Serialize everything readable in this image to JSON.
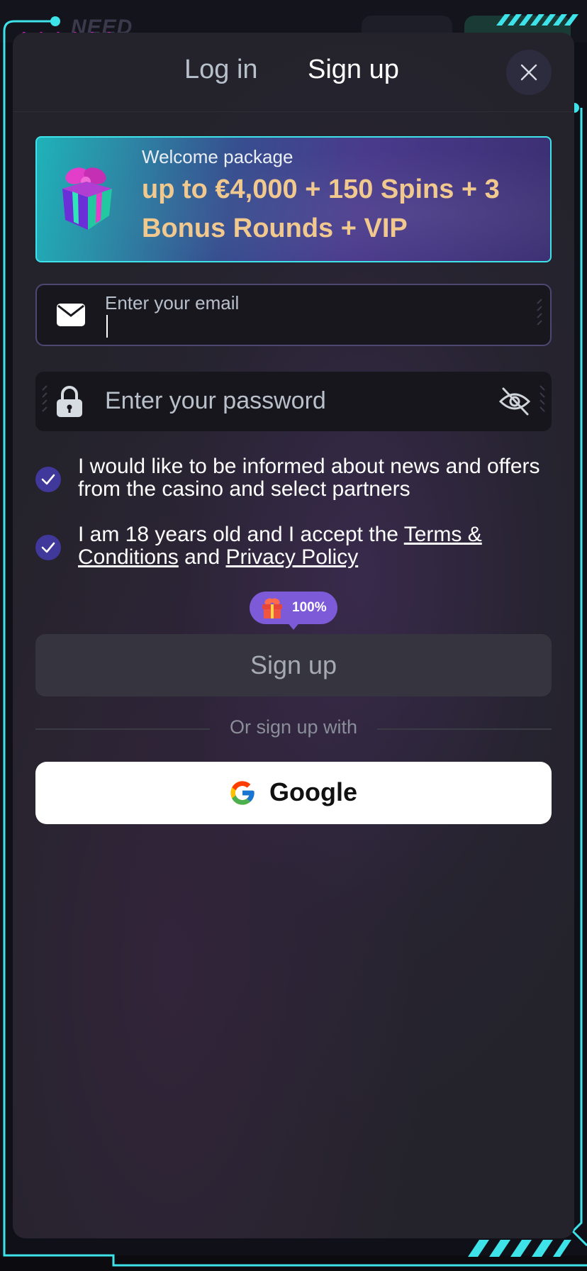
{
  "background": {
    "logo_text": "NEED"
  },
  "tabs": [
    {
      "label": "Log in",
      "active": false
    },
    {
      "label": "Sign up",
      "active": true
    }
  ],
  "close_icon": "close-icon",
  "banner": {
    "subtitle": "Welcome package",
    "offer": "up to €4,000 + 150 Spins + 3 Bonus Rounds + VIP",
    "icon": "gift-icon"
  },
  "email": {
    "label": "Enter your email",
    "value": "",
    "icon": "envelope-icon"
  },
  "password": {
    "placeholder": "Enter your password",
    "value": "",
    "icon": "lock-icon",
    "toggle_icon": "eye-off-icon"
  },
  "consents": {
    "news": {
      "checked": true,
      "text": "I would like to be informed about news and offers from the casino and select partners"
    },
    "terms": {
      "checked": true,
      "prefix": "I am 18 years old and I accept the ",
      "terms_link": "Terms & Conditions",
      "and": " and ",
      "privacy_link": "Privacy Policy"
    }
  },
  "bonus_badge": {
    "percent": "100%",
    "icon": "gift-icon"
  },
  "signup_button": {
    "label": "Sign up"
  },
  "divider": {
    "text": "Or sign up with"
  },
  "google_button": {
    "label": "Google",
    "icon": "google-icon"
  },
  "colors": {
    "accent_neon": "#3de3e8",
    "accent_magenta": "#e81ee0",
    "offer_gold": "#f1c98e",
    "checkbox": "#40389a",
    "badge": "#7c5ad8"
  }
}
